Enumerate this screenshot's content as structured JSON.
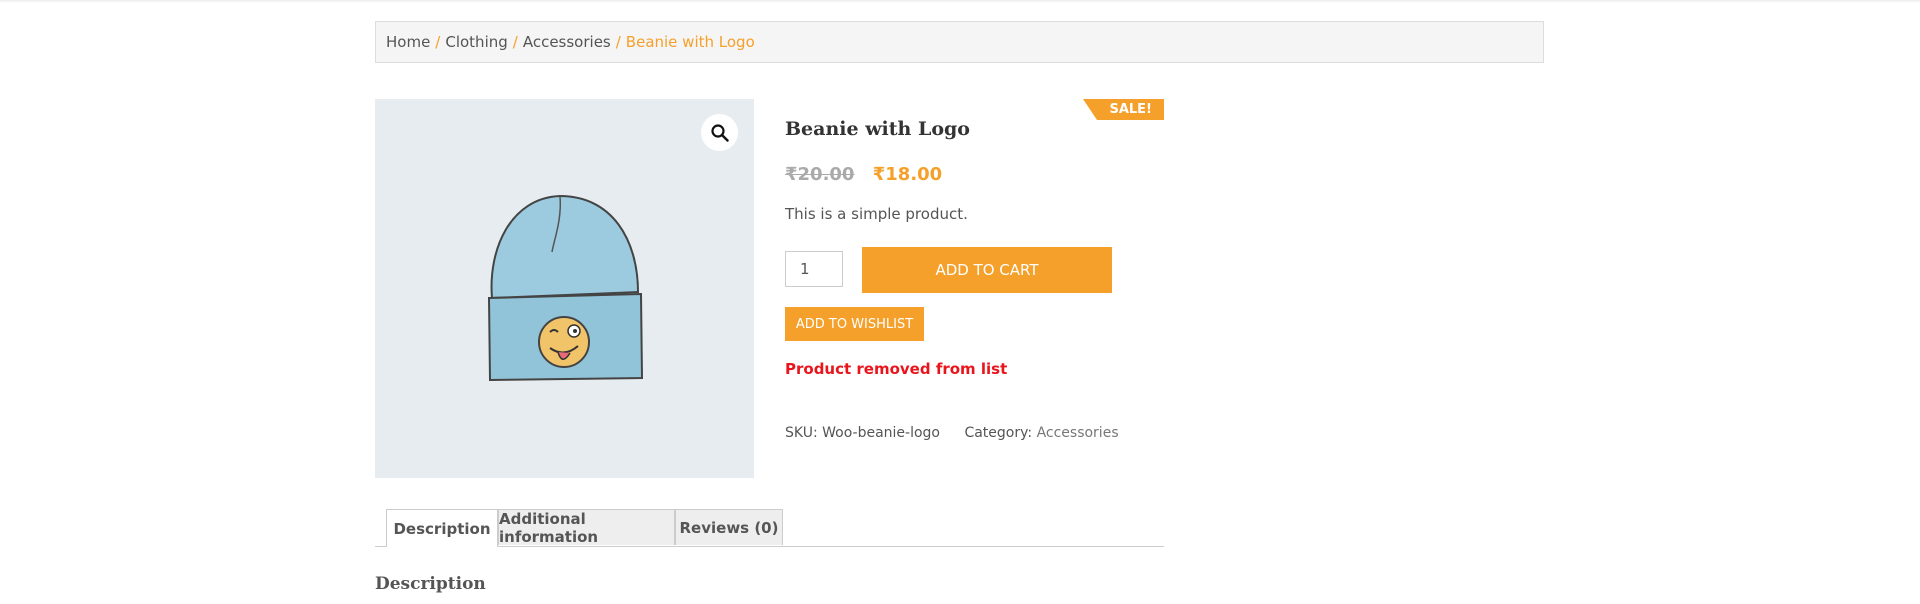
{
  "breadcrumb": {
    "items": [
      "Home",
      "Clothing",
      "Accessories"
    ],
    "separator": "/",
    "current": "Beanie with Logo"
  },
  "product": {
    "sale_badge": "SALE!",
    "title": "Beanie with Logo",
    "old_price": "₹20.00",
    "new_price": "₹18.00",
    "short_description": "This is a simple product.",
    "quantity": "1",
    "add_to_cart_label": "ADD TO CART",
    "add_to_wishlist_label": "ADD TO WISHLIST",
    "notice": "Product removed from list",
    "sku_label": "SKU:",
    "sku_value": "Woo-beanie-logo",
    "category_label": "Category:",
    "category_value": "Accessories"
  },
  "tabs": [
    {
      "label": "Description"
    },
    {
      "label": "Additional information"
    },
    {
      "label": "Reviews (0)"
    }
  ],
  "description_heading": "Description",
  "colors": {
    "accent": "#f5a02a",
    "error": "#e8151c"
  },
  "icons": {
    "zoom": "search-icon"
  }
}
